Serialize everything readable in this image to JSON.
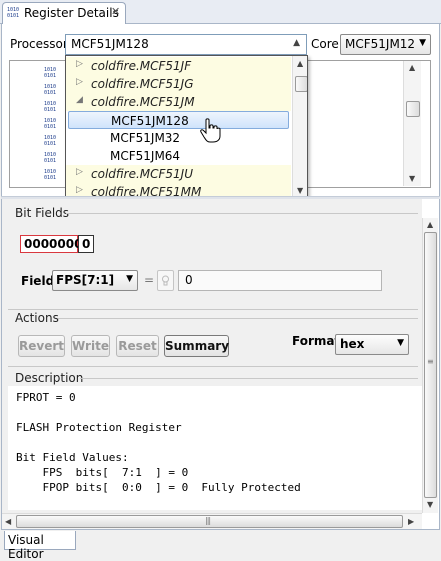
{
  "tab": {
    "title": "Register Details",
    "close": "✕",
    "icon_text": "1010\n0101"
  },
  "processor": {
    "label": "Processor",
    "value": "MCF51JM128"
  },
  "core": {
    "label": "Core",
    "value": "MCF51JM128"
  },
  "tree": [
    {
      "label": "coldfire.MCF51JF",
      "kind": "family",
      "expanded": false
    },
    {
      "label": "coldfire.MCF51JG",
      "kind": "family",
      "expanded": false
    },
    {
      "label": "coldfire.MCF51JM",
      "kind": "family",
      "expanded": true
    },
    {
      "label": "MCF51JM128",
      "kind": "device",
      "selected": true
    },
    {
      "label": "MCF51JM32",
      "kind": "device"
    },
    {
      "label": "MCF51JM64",
      "kind": "device"
    },
    {
      "label": "coldfire.MCF51JU",
      "kind": "family",
      "expanded": false
    },
    {
      "label": "coldfire.MCF51MM",
      "kind": "family",
      "expanded": false
    }
  ],
  "bitfields": {
    "title": "Bit Fields",
    "bits_hi": "0000000",
    "bits_lo": "0",
    "field_label": "Field",
    "field_value": "FPS[7:1]",
    "equals": "=",
    "value": "0"
  },
  "actions": {
    "title": "Actions",
    "revert": "Revert",
    "write": "Write",
    "reset": "Reset",
    "summary": "Summary",
    "format_label": "Format",
    "format_value": "hex"
  },
  "description": {
    "title": "Description",
    "lines": [
      "FPROT = 0",
      "",
      "FLASH Protection Register",
      "",
      "Bit Field Values:",
      "    FPS  bits[  7:1  ] = 0",
      "    FPOP bits[  0:0  ] = 0  Fully Protected"
    ]
  },
  "bottom_tab": {
    "title": "Visual Editor"
  },
  "colors": {
    "selection": "#cfe3fb",
    "family_bg": "#fdfce2",
    "bits_border": "#d9383f"
  }
}
